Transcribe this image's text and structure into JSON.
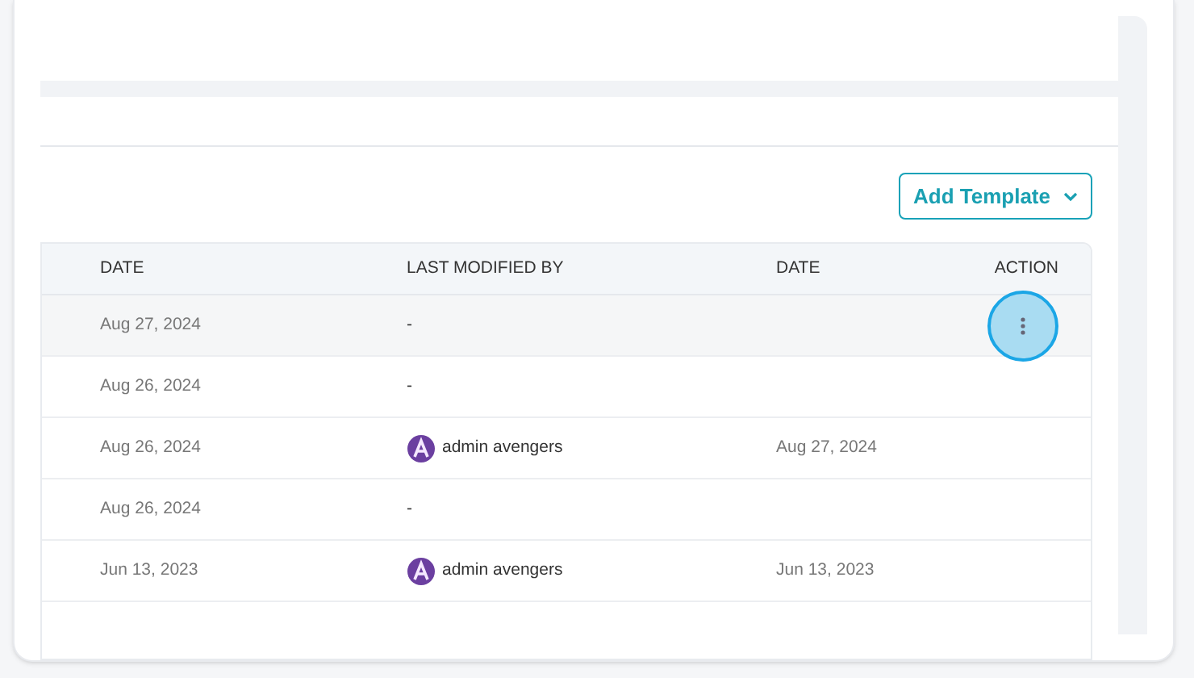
{
  "toolbar": {
    "add_button": "Add Template"
  },
  "table": {
    "columns": [
      "DATE",
      "LAST MODIFIED BY",
      "DATE",
      "ACTION"
    ],
    "rows": [
      {
        "date": "Aug 27, 2024",
        "modified_by": "-",
        "has_avatar": false,
        "highlighted": true
      },
      {
        "date": "Aug 26, 2024",
        "modified_by": "-",
        "has_avatar": false,
        "highlighted": false
      },
      {
        "date": "Aug 26, 2024",
        "modified_by": "admin avengers",
        "has_avatar": true,
        "modified_date": "Aug 27, 2024",
        "highlighted": false
      },
      {
        "date": "Aug 26, 2024",
        "modified_by": "-",
        "has_avatar": false,
        "highlighted": false
      },
      {
        "date": "Jun 13, 2023",
        "modified_by": "admin avengers",
        "has_avatar": true,
        "modified_date": "Jun 13, 2023",
        "highlighted": false
      }
    ]
  }
}
